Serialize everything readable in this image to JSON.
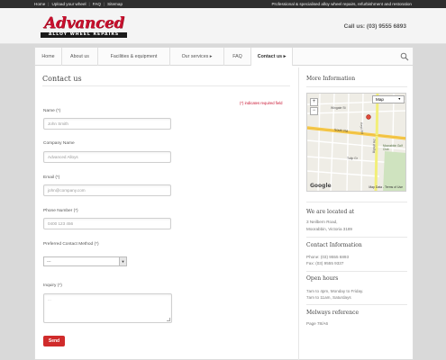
{
  "topbar": {
    "links": [
      "Home",
      "Upload your wheel",
      "FAQ",
      "Sitemap"
    ],
    "tagline": "Professional & specialised alloy wheel repairs, refurbishment and restoration"
  },
  "header": {
    "logo_word": "Advanced",
    "logo_band": "ALLOY WHEEL REPAIRS",
    "call_us": "Call us: (03) 9555 6893"
  },
  "nav": {
    "items": [
      "Home",
      "About us",
      "Facilities & equipment",
      "Our services ▸",
      "FAQ",
      "Contact us ▸"
    ],
    "active_index": 5
  },
  "form": {
    "title": "Contact us",
    "required_note": "(*) indicates required field",
    "name_label": "Name (*)",
    "name_placeholder": "John Smith",
    "company_label": "Company Name",
    "company_placeholder": "Advanced Alloys",
    "email_label": "Email (*)",
    "email_placeholder": "john@company.com",
    "phone_label": "Phone Number (*)",
    "phone_placeholder": "0400 123 456",
    "contact_method_label": "Preferred Contact Method (*)",
    "contact_method_value": "---",
    "inquiry_label": "Inquiry (*)",
    "inquiry_placeholder": "...",
    "send_label": "Send"
  },
  "sidebar": {
    "more_info_title": "More Information",
    "map": {
      "type_button": "Map",
      "streets": [
        "Wingate St",
        "Keys Rd",
        "South Rd",
        "Bignell Rd",
        "Tulip Gr",
        "Moorabbin Golf Club"
      ],
      "footer_logo": "Google",
      "map_data": "Map Data",
      "terms": "Terms of Use"
    },
    "located_title": "We are located at",
    "address_line1": "3 Neilbern Road,",
    "address_line2": "Moorabbin, Victoria 3189",
    "contact_title": "Contact Information",
    "phone_line": "Phone: (03) 9555 6893",
    "fax_line": "Fax: (03) 9555 9337",
    "hours_title": "Open hours",
    "hours_line1": "7am to 4pm, Monday to Friday.",
    "hours_line2": "7am to 11am, Saturdays",
    "melways_title": "Melways reference",
    "melways_value": "Page 78/A6"
  },
  "colors": {
    "brand_red": "#c8102e",
    "button_red": "#d02b2b",
    "topbar_bg": "#2e2e2e"
  }
}
